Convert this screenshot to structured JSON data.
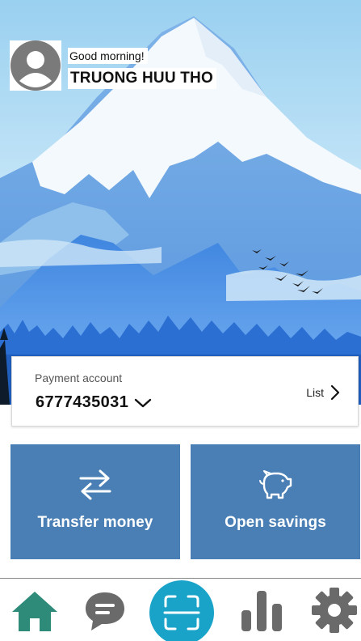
{
  "header": {
    "greeting": "Good morning!",
    "username": "TRUONG HUU THO",
    "avatar_icon": "person-icon"
  },
  "account": {
    "label": "Payment account",
    "number": "6777435031",
    "list_label": "List"
  },
  "actions": [
    {
      "label": "Transfer money",
      "icon": "transfer-arrows-icon"
    },
    {
      "label": "Open savings",
      "icon": "piggy-bank-icon"
    }
  ],
  "bottom_nav": [
    {
      "name": "home",
      "icon": "home-icon",
      "color": "#2e8b7a",
      "active": true
    },
    {
      "name": "chat",
      "icon": "chat-icon",
      "color": "#6a6a6a"
    },
    {
      "name": "scan",
      "icon": "scan-icon",
      "color": "#1aa3c8"
    },
    {
      "name": "stats",
      "icon": "bar-chart-icon",
      "color": "#6a6a6a"
    },
    {
      "name": "settings",
      "icon": "gear-icon",
      "color": "#6a6a6a"
    }
  ],
  "colors": {
    "tile": "#4a7fb5",
    "accent": "#1aa3c8",
    "home_active": "#2e8b7a"
  }
}
